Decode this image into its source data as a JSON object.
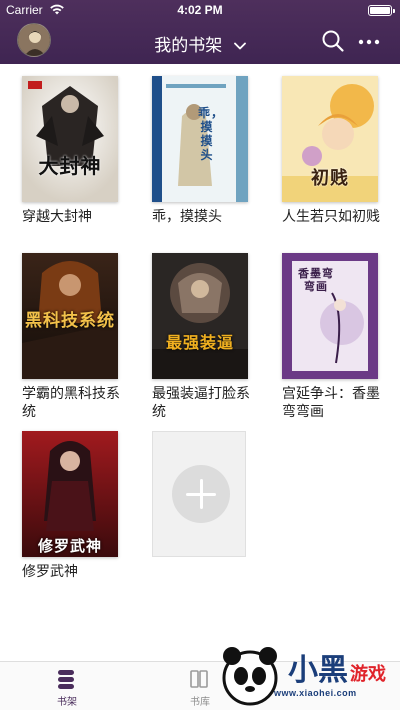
{
  "status_bar": {
    "carrier": "Carrier",
    "time": "4:02 PM",
    "battery_level": 1.0
  },
  "nav": {
    "title": "我的书架",
    "search_icon": "search-icon",
    "more_icon": "more-dots-icon",
    "chevron_icon": "chevron-down-icon"
  },
  "books": [
    {
      "title": "穿越大封神",
      "cover_text": "大封神",
      "cover_colors": [
        "#e9e4dc",
        "#222222",
        "#c21d1d"
      ]
    },
    {
      "title": "乖，摸摸头",
      "cover_text": "乖，摸摸头",
      "cover_colors": [
        "#d8e7ee",
        "#6fa3c0",
        "#1f4f8a"
      ]
    },
    {
      "title": "人生若只如初贱",
      "cover_text": "初贱",
      "cover_colors": [
        "#f6e6b3",
        "#e9a03a",
        "#5a3a1a"
      ]
    },
    {
      "title": "学霸的黑科技系统",
      "cover_text": "黑科技系统",
      "cover_colors": [
        "#1c1410",
        "#7a3b14",
        "#f2c14a"
      ]
    },
    {
      "title": "最强装逼打脸系统",
      "cover_text": "最强装逼",
      "cover_colors": [
        "#1a1a1a",
        "#4a3a32",
        "#f0b020"
      ]
    },
    {
      "title": "宫延争斗：香墨弯弯画",
      "cover_text": "香墨弯弯画",
      "cover_colors": [
        "#6b3a86",
        "#efe6f2",
        "#3a1e4a"
      ]
    },
    {
      "title": "修罗武神",
      "cover_text": "修罗武神",
      "cover_colors": [
        "#7a0f14",
        "#1b0b0d",
        "#f5f5f5"
      ]
    }
  ],
  "add_book": {
    "icon": "plus-icon"
  },
  "tabs": [
    {
      "label": "书架",
      "icon": "bookshelf-icon",
      "active": true
    },
    {
      "label": "书库",
      "icon": "library-icon",
      "active": false
    }
  ],
  "watermark": {
    "text": "www.xiaohei.com",
    "logo_text": "小黑游戏"
  },
  "colors": {
    "header": "#4e2f5c",
    "accent": "#4a2d5c",
    "tab_inactive": "#8e8e8e"
  }
}
